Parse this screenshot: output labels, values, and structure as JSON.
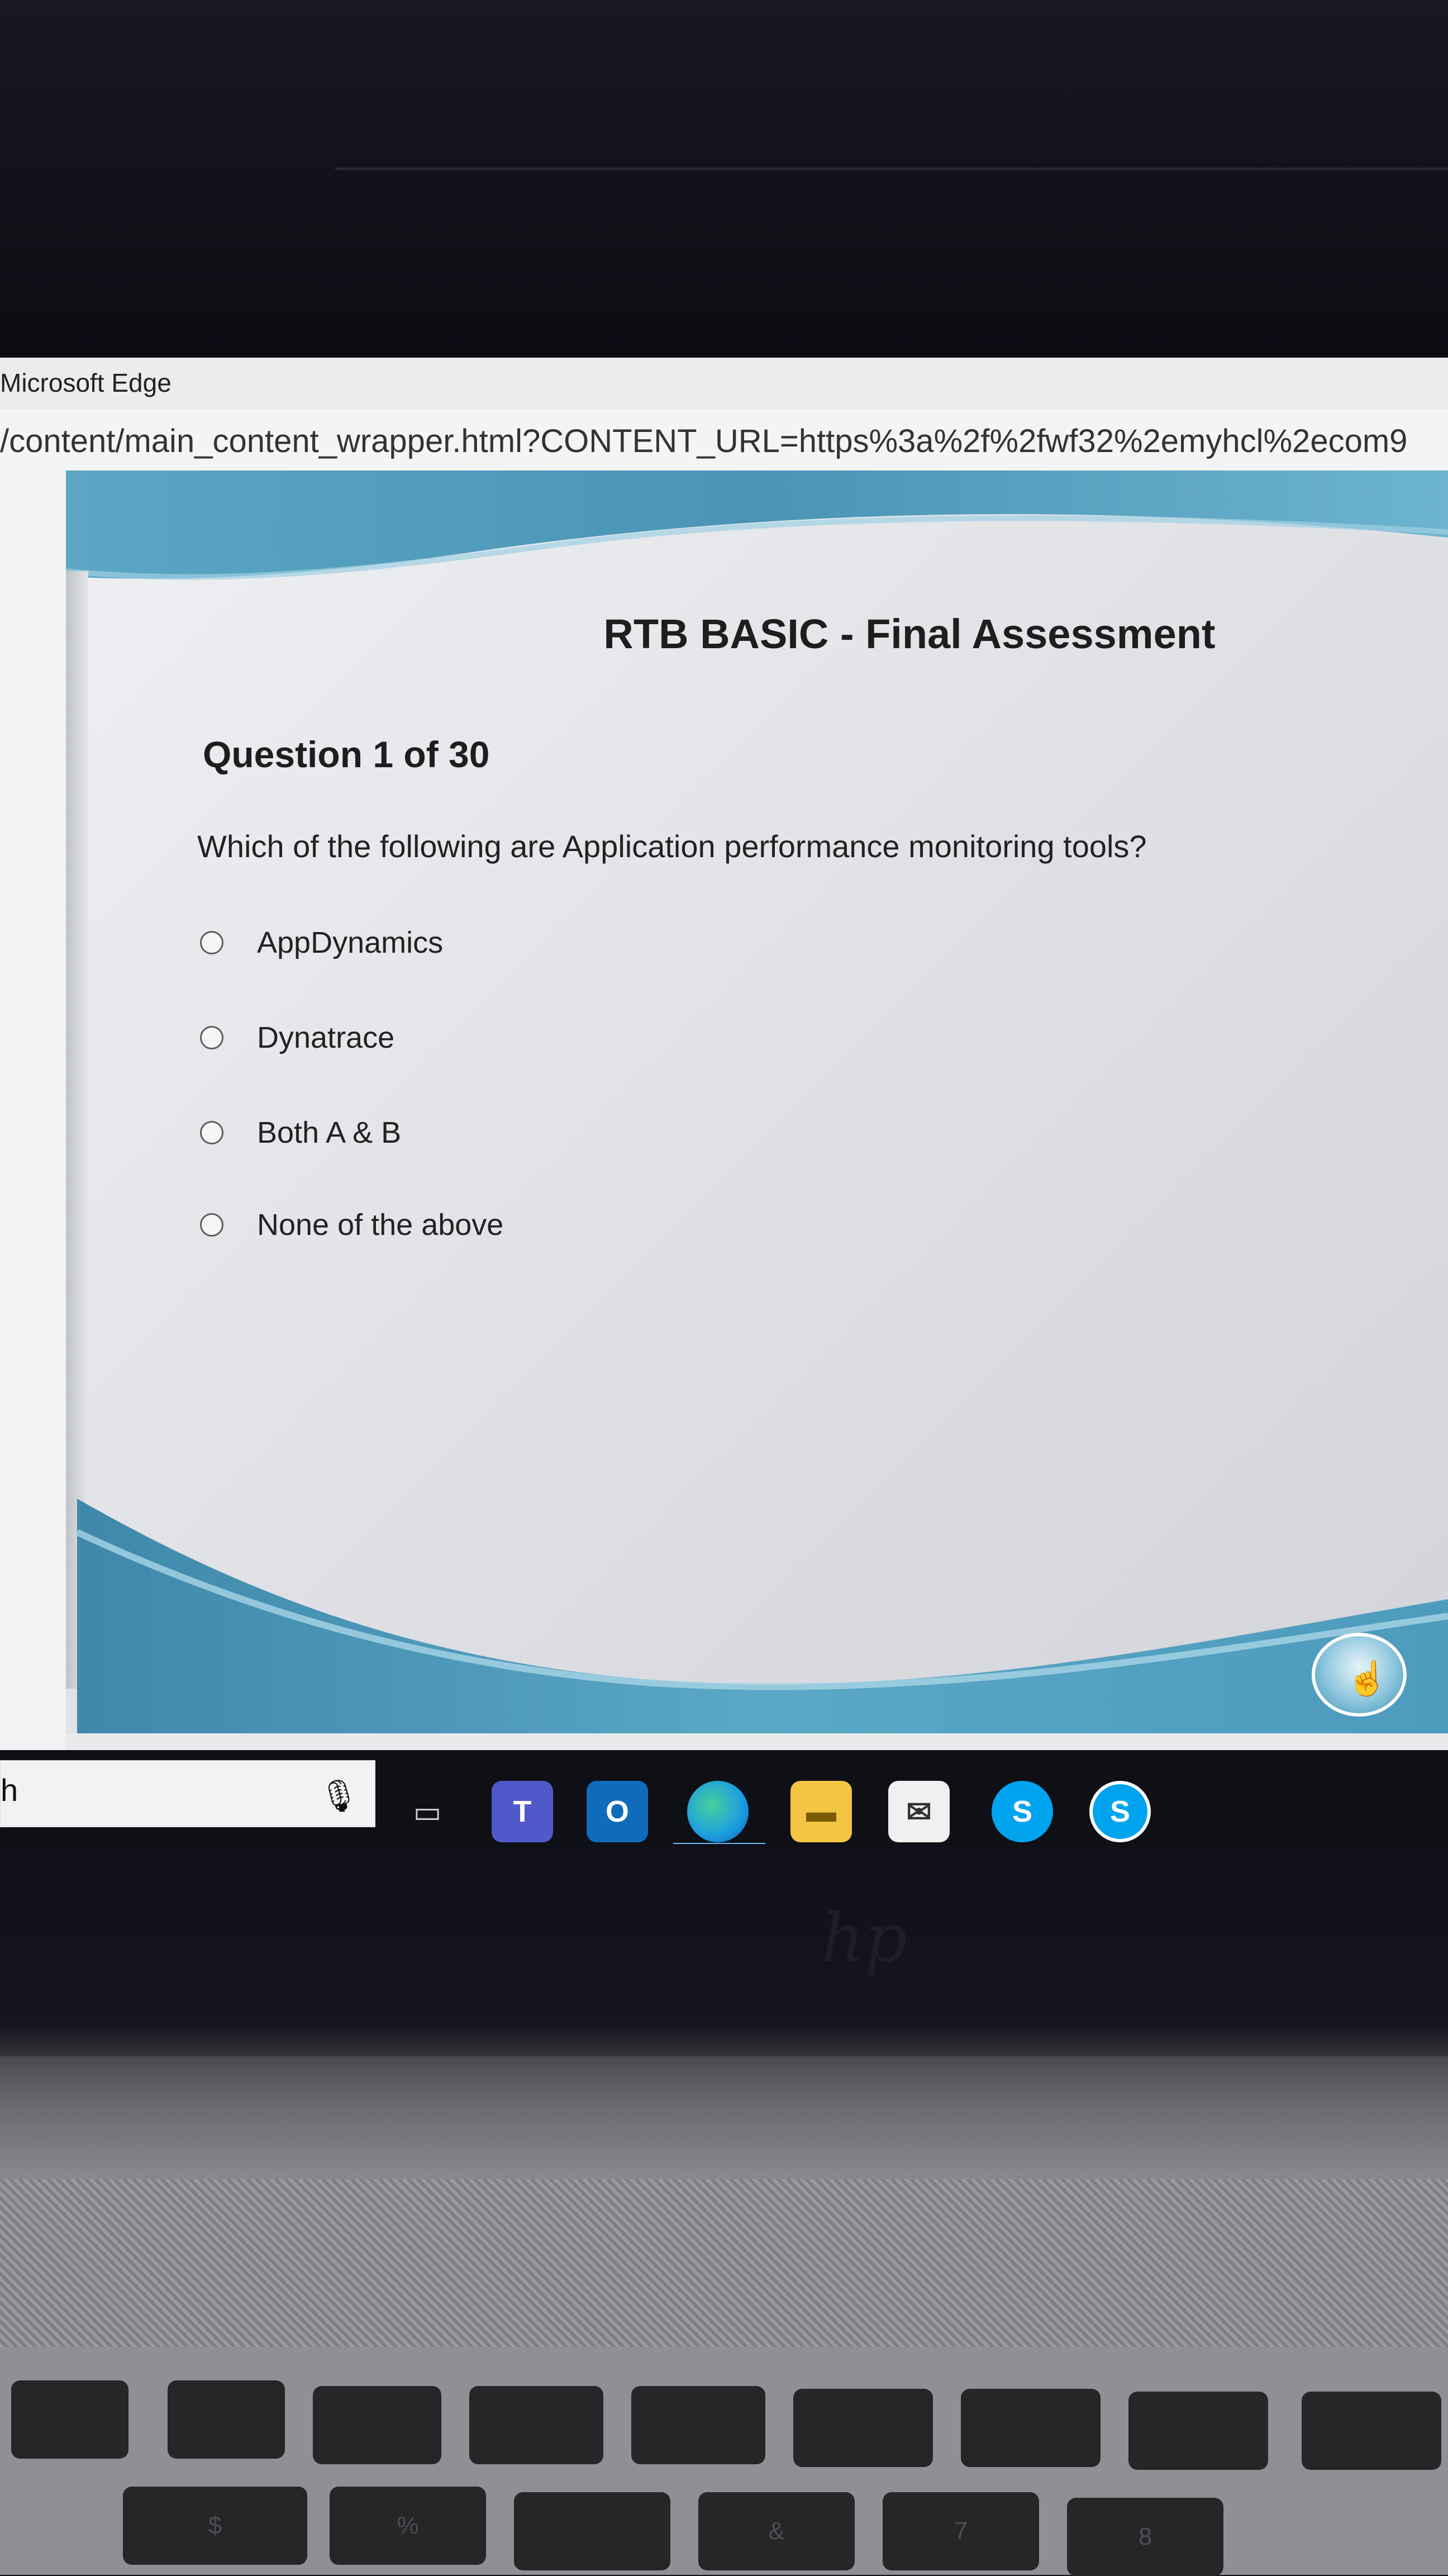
{
  "window": {
    "title": "Microsoft Edge"
  },
  "address_bar": {
    "url": "/content/main_content_wrapper.html?CONTENT_URL=https%3a%2f%2fwf32%2emyhcl%2ecom9"
  },
  "slide": {
    "title": "RTB BASIC - Final Assessment",
    "question_heading": "Question 1 of 30",
    "question_text": "Which of the following are Application performance monitoring tools?",
    "options": [
      {
        "label": "AppDynamics"
      },
      {
        "label": "Dynatrace"
      },
      {
        "label": "Both A & B"
      },
      {
        "label": "None of the above"
      }
    ],
    "nav_button_icon": "hand-pointer-icon"
  },
  "taskbar": {
    "search_text": "h",
    "icons": [
      "microphone-icon",
      "task-view-icon",
      "teams-icon",
      "outlook-icon",
      "edge-icon",
      "file-explorer-icon",
      "mail-icon",
      "skype-icon",
      "skype-icon"
    ],
    "labels": {
      "teams": "T",
      "outlook": "O",
      "skype": "S"
    }
  },
  "keyboard": {
    "keys": [
      "$",
      "%",
      "&",
      "7",
      "8"
    ]
  }
}
